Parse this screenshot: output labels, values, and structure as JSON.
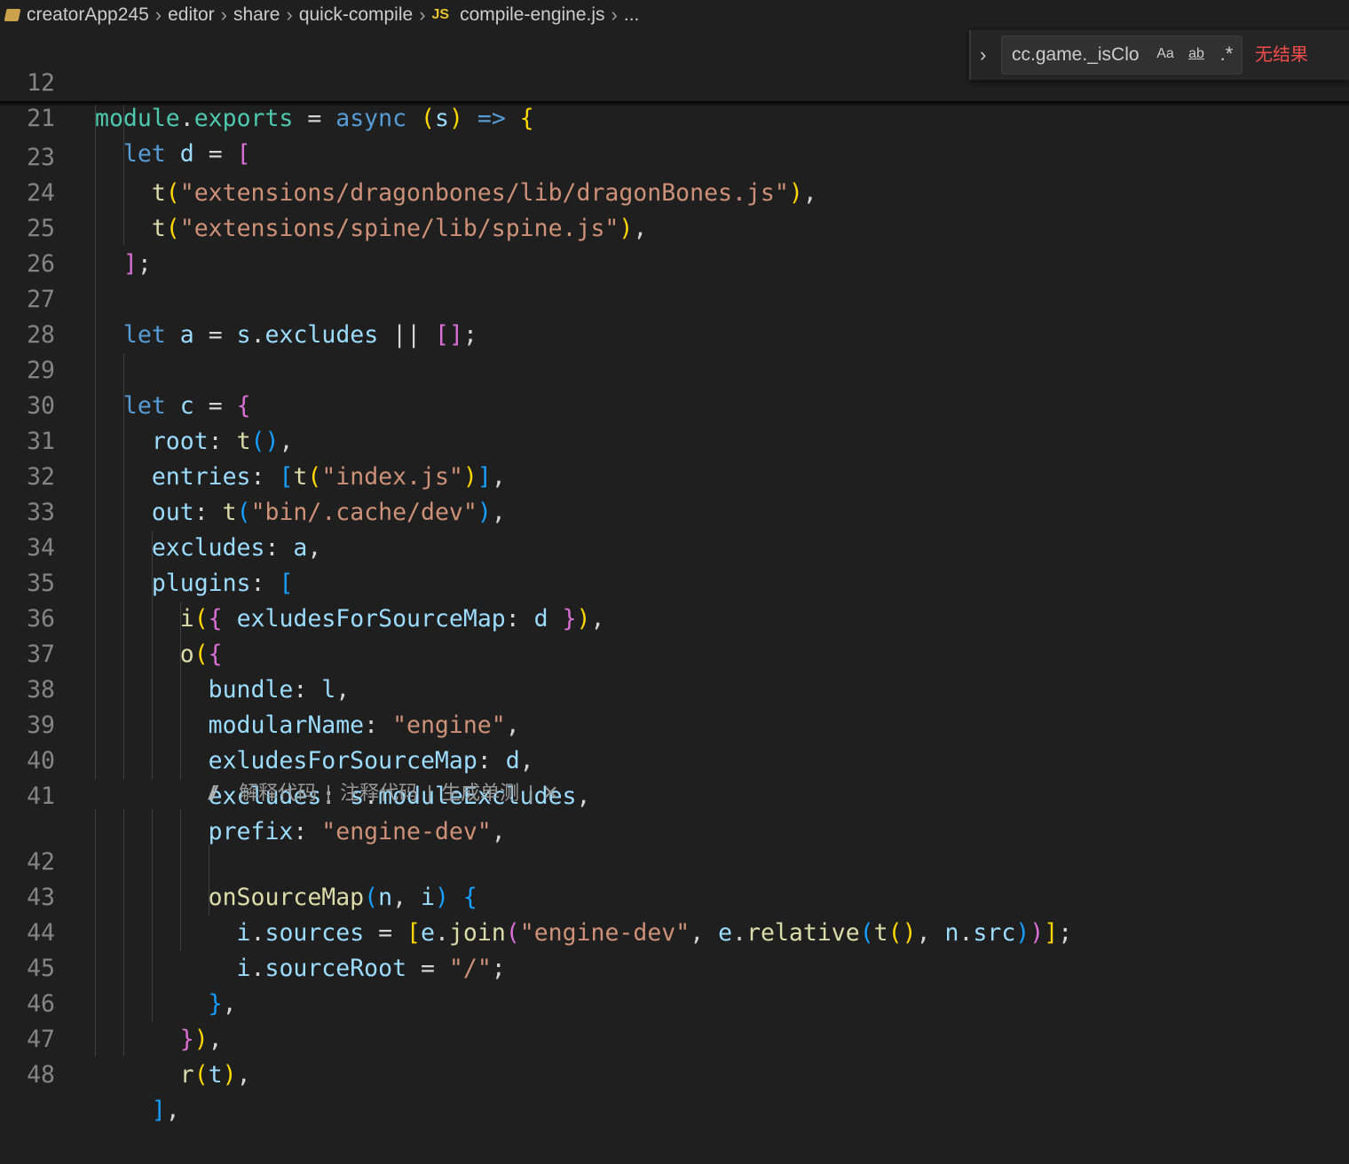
{
  "breadcrumb": {
    "items": [
      "creatorApp245",
      "editor",
      "share",
      "quick-compile"
    ],
    "file_badge": "JS",
    "file": "compile-engine.js",
    "trailing": "..."
  },
  "find_widget": {
    "query": "cc.game._isClo",
    "match_case_label": "Aa",
    "whole_word_label": "ab",
    "regex_label": ".*",
    "result_text": "无结果"
  },
  "codelens": {
    "items": [
      "解释代码",
      "注释代码",
      "生成单测"
    ],
    "separator": "|",
    "close": "✕"
  },
  "editor": {
    "line_numbers": {
      "l12": "12",
      "l21": "21",
      "l23": "23",
      "l24": "24",
      "l25": "25",
      "l26": "26",
      "l27": "27",
      "l28": "28",
      "l29": "29",
      "l30": "30",
      "l31": "31",
      "l32": "32",
      "l33": "33",
      "l34": "34",
      "l35": "35",
      "l36": "36",
      "l37": "37",
      "l38": "38",
      "l39": "39",
      "l40": "40",
      "l41": "41",
      "l42": "42",
      "l43": "43",
      "l44": "44",
      "l45": "45",
      "l46": "46",
      "l47": "47",
      "l48": "48"
    },
    "tokens": {
      "module": "module",
      "exports": "exports",
      "async": "async",
      "s": "s",
      "arrow": "=>",
      "let": "let",
      "d": "d",
      "a": "a",
      "c": "c",
      "t": "t",
      "i": "i",
      "o": "o",
      "r": "r",
      "e": "e",
      "n": "n",
      "l": "l",
      "str_dragon": "\"extensions/dragonbones/lib/dragonBones.js\"",
      "str_spine": "\"extensions/spine/lib/spine.js\"",
      "excludes": "excludes",
      "root": "root",
      "entries": "entries",
      "out": "out",
      "plugins": "plugins",
      "str_index": "\"index.js\"",
      "str_cache": "\"bin/.cache/dev\"",
      "exludesForSourceMap": "exludesForSourceMap",
      "bundle": "bundle",
      "modularName": "modularName",
      "str_engine": "\"engine\"",
      "moduleExcludes": "moduleExcludes",
      "prefix": "prefix",
      "str_engine_dev": "\"engine-dev\"",
      "onSourceMap": "onSourceMap",
      "sources": "sources",
      "join": "join",
      "relative": "relative",
      "src": "src",
      "sourceRoot": "sourceRoot",
      "str_slash": "\"/\""
    }
  }
}
